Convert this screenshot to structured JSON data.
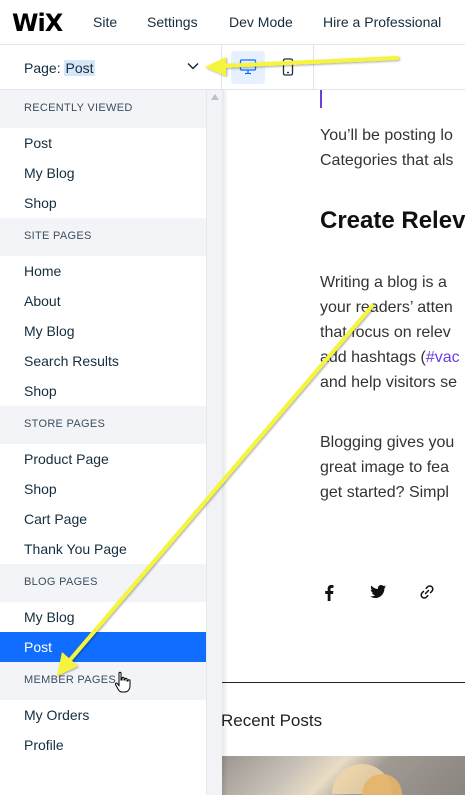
{
  "topbar": {
    "logo": "WiX",
    "menu": [
      "Site",
      "Settings",
      "Dev Mode",
      "Hire a Professional"
    ]
  },
  "pagebar": {
    "label": "Page:",
    "value": "Post",
    "devices": [
      "desktop-icon",
      "mobile-icon"
    ]
  },
  "sidebar": {
    "sections": [
      {
        "title": "RECENTLY VIEWED",
        "items": [
          "Post",
          "My Blog",
          "Shop"
        ]
      },
      {
        "title": "SITE PAGES",
        "items": [
          "Home",
          "About",
          "My Blog",
          "Search Results",
          "Shop"
        ]
      },
      {
        "title": "STORE PAGES",
        "items": [
          "Product Page",
          "Shop",
          "Cart Page",
          "Thank You Page"
        ]
      },
      {
        "title": "BLOG PAGES",
        "items": [
          "My Blog",
          "Post"
        ]
      },
      {
        "title": "MEMBER PAGES",
        "items": [
          "My Orders",
          "Profile"
        ]
      }
    ],
    "selected": "Post"
  },
  "canvas": {
    "para1": [
      "You’ll be posting lo",
      "Categories that als"
    ],
    "heading": "Create Relev",
    "para2_line1": "Writing a blog is a",
    "para2_line2": "your readers’ atten",
    "para2_line3": "that focus on relev",
    "para2_line4_pre": "add hashtags (",
    "para2_line4_tag": "#vac",
    "para2_line5": "and help visitors se",
    "para3": [
      "Blogging gives you",
      "great image to fea",
      "get started? Simpl"
    ],
    "share_icons": [
      "facebook-icon",
      "twitter-icon",
      "link-icon"
    ],
    "recent_posts": "Recent Posts"
  },
  "colors": {
    "accent": "#116dff",
    "annotation_arrow": "#f5f53a",
    "hashtag": "#6b3fe0"
  }
}
